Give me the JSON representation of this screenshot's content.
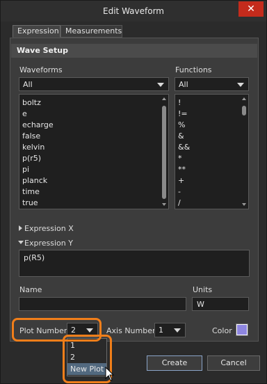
{
  "window": {
    "title": "Edit Waveform",
    "close_glyph": "✕"
  },
  "tabs": [
    {
      "label": "Expression",
      "active": true
    },
    {
      "label": "Measurements",
      "active": false
    }
  ],
  "wave_setup": {
    "header": "Wave Setup",
    "waveforms_label": "Waveforms",
    "waveforms_filter": "All",
    "waveforms": [
      "boltz",
      "e",
      "echarge",
      "false",
      "kelvin",
      "p(r5)",
      "pi",
      "planck",
      "time",
      "true"
    ],
    "functions_label": "Functions",
    "functions_filter": "All",
    "functions": [
      "!",
      "!=",
      "%",
      "&",
      "&&",
      "*",
      "**",
      "+",
      "-",
      "/"
    ]
  },
  "expression_x": {
    "label": "Expression X",
    "expanded": false
  },
  "expression_y": {
    "label": "Expression Y",
    "expanded": true,
    "value": "p(R5)"
  },
  "name": {
    "label": "Name",
    "value": ""
  },
  "units": {
    "label": "Units",
    "value": "W"
  },
  "plot_number": {
    "label": "Plot Number",
    "value": "2",
    "options": [
      "1",
      "2",
      "New Plot"
    ],
    "highlighted_option": "New Plot"
  },
  "axis_number": {
    "label": "Axis Number",
    "value": "1"
  },
  "color": {
    "label": "Color",
    "swatch": "#8e86e0"
  },
  "buttons": {
    "create": "Create",
    "cancel": "Cancel"
  },
  "colors": {
    "highlight": "#f07e1a",
    "close": "#c42b1c",
    "selected_item": "#52697f"
  }
}
